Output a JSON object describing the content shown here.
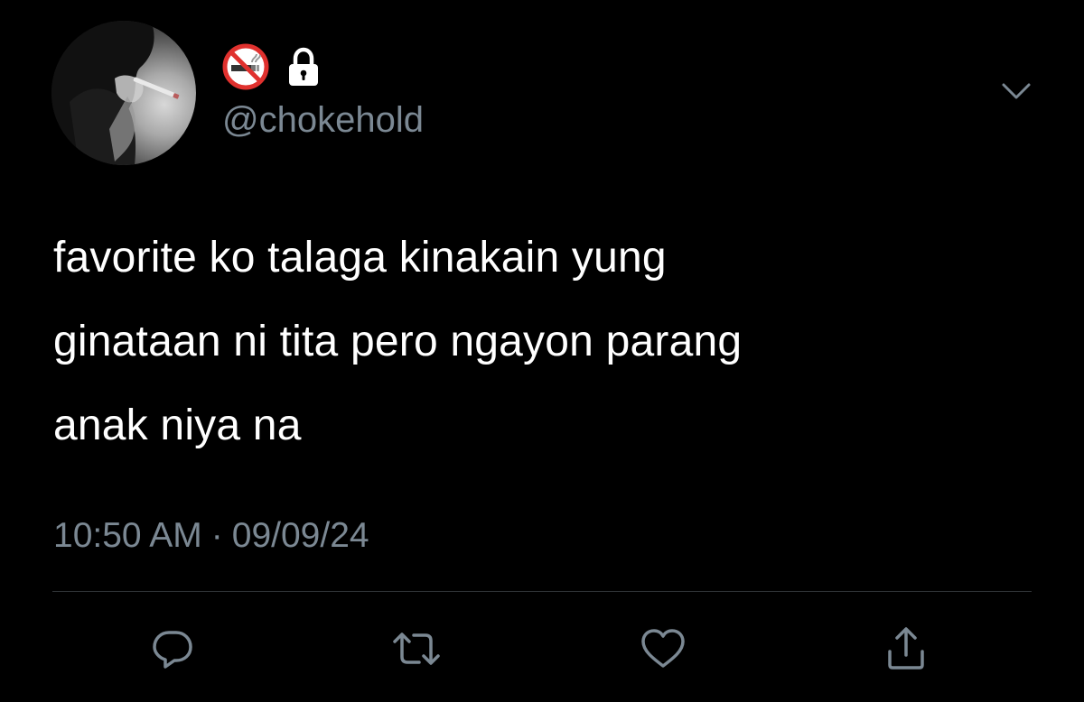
{
  "tweet": {
    "handle": "@chokehold",
    "display_name_icons": [
      "no-smoking-icon",
      "lock-icon"
    ],
    "text_lines": [
      "favorite ko talaga kinakain yung",
      "ginataan ni tita pero ngayon parang",
      "anak niya na"
    ],
    "time": "10:50 AM",
    "separator": "·",
    "date": "09/09/24"
  },
  "actions": [
    {
      "icon": "reply-icon"
    },
    {
      "icon": "retweet-icon"
    },
    {
      "icon": "like-icon"
    },
    {
      "icon": "share-icon"
    }
  ],
  "colors": {
    "background": "#000000",
    "text": "#ffffff",
    "secondary_text": "#7b8893",
    "divider": "#2f3336",
    "no_smoking_red": "#e0312e"
  }
}
